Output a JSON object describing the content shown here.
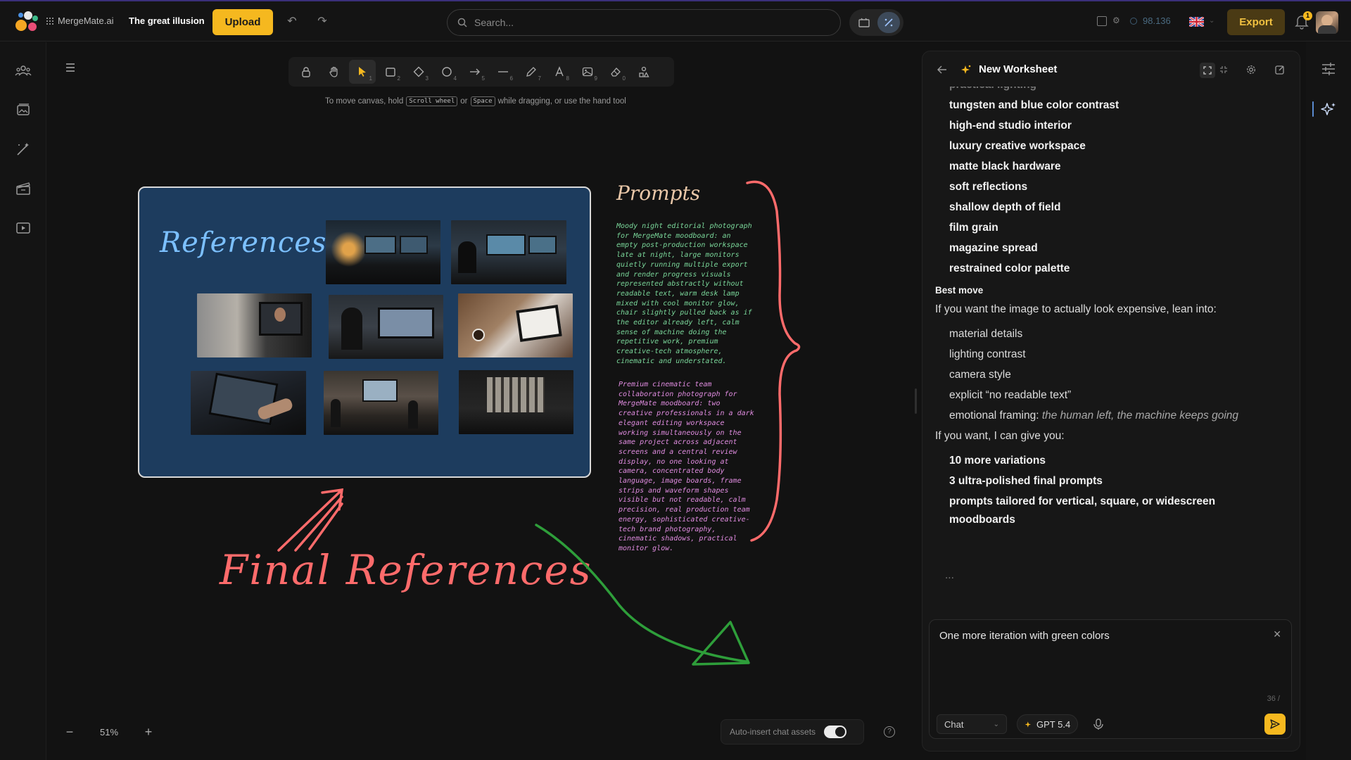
{
  "app": {
    "brand": "MergeMate.ai",
    "project_title": "The great illusion"
  },
  "header": {
    "upload_label": "Upload",
    "search_placeholder": "Search...",
    "credits": "98.136",
    "export_label": "Export",
    "notification_count": "1"
  },
  "toolbar": {
    "tools": [
      {
        "name": "lock-tool",
        "num": ""
      },
      {
        "name": "hand-tool",
        "num": ""
      },
      {
        "name": "select-tool",
        "num": "1"
      },
      {
        "name": "rectangle-tool",
        "num": "2"
      },
      {
        "name": "diamond-tool",
        "num": "3"
      },
      {
        "name": "ellipse-tool",
        "num": "4"
      },
      {
        "name": "arrow-tool",
        "num": "5"
      },
      {
        "name": "line-tool",
        "num": "6"
      },
      {
        "name": "pencil-tool",
        "num": "7"
      },
      {
        "name": "text-tool",
        "num": "8"
      },
      {
        "name": "image-tool",
        "num": "9"
      },
      {
        "name": "eraser-tool",
        "num": "0"
      },
      {
        "name": "shapes-library-tool",
        "num": ""
      }
    ],
    "hint_prefix": "To move canvas, hold",
    "hint_key1": "Scroll wheel",
    "hint_or": "or",
    "hint_key2": "Space",
    "hint_suffix": "while dragging, or use the hand tool"
  },
  "canvas": {
    "references_title": "References",
    "prompts_title": "Prompts",
    "prompt1": "Moody night editorial photograph for MergeMate moodboard: an empty post-production workspace late at night, large monitors quietly running multiple export and render progress visuals represented abstractly without readable text, warm desk lamp mixed with cool monitor glow, chair slightly pulled back as if the editor already left, calm sense of machine doing the repetitive work, premium creative-tech atmosphere, cinematic and understated.",
    "prompt2": "Premium cinematic team collaboration photograph for MergeMate moodboard: two creative professionals in a dark elegant editing workspace working simultaneously on the same project across adjacent screens and a central review display, no one looking at camera, concentrated body language, image boards, frame strips and waveform shapes visible but not readable, calm precision, real production team energy, sophisticated creative-tech brand photography, cinematic shadows, practical monitor glow.",
    "final_references": "Final References",
    "zoom": "51%",
    "auto_insert_label": "Auto-insert chat assets"
  },
  "panel": {
    "title": "New Worksheet",
    "partial_top": "practical lighting",
    "list1": [
      "tungsten and blue color contrast",
      "high-end studio interior",
      "luxury creative workspace",
      "matte black hardware",
      "soft reflections",
      "shallow depth of field",
      "film grain",
      "magazine spread",
      "restrained color palette"
    ],
    "best_move_heading": "Best move",
    "best_move_intro": "If you want the image to actually look expensive, lean into:",
    "list2": [
      "material details",
      "lighting contrast",
      "camera style",
      "explicit “no readable text”"
    ],
    "emotional_label": "emotional framing:",
    "emotional_value": "the human left, the machine keeps going",
    "give_intro": "If you want, I can give you:",
    "list3": [
      "10 more variations",
      "3 ultra-polished final prompts",
      "prompts tailored for vertical, square, or widescreen",
      "moodboards"
    ],
    "ellipsis": "..."
  },
  "composer": {
    "value": "One more iteration with green colors",
    "counter": "36 /",
    "mode": "Chat",
    "model": "GPT 5.4"
  },
  "colors": {
    "accent": "#f5b81f",
    "board": "#1d3c5e",
    "annotation_red": "#ff6b6b",
    "annotation_green": "#2e9e3a"
  }
}
